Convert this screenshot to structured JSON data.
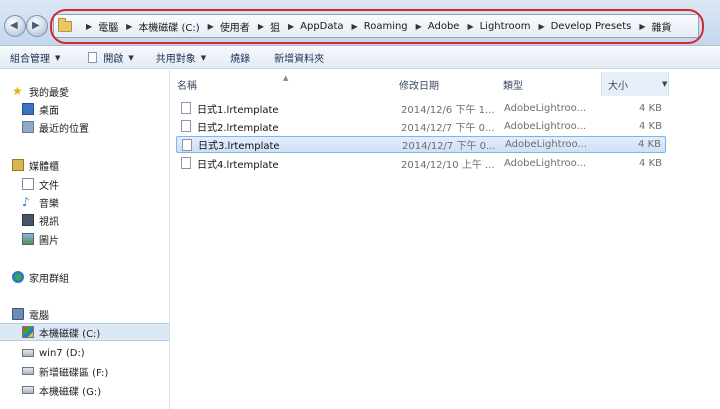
{
  "nav_buttons": {
    "back_icon": "back-arrow-icon",
    "forward_icon": "forward-arrow-icon"
  },
  "breadcrumb": [
    "電腦",
    "本機磁碟 (C:)",
    "使用者",
    "狙",
    "AppData",
    "Roaming",
    "Adobe",
    "Lightroom",
    "Develop Presets",
    "雜貨"
  ],
  "toolbar": {
    "organize_label": "組合管理",
    "open_label": "開啟",
    "share_label": "共用對象",
    "burn_label": "燒錄",
    "new_folder_label": "新增資料夾"
  },
  "navpane": {
    "favorites": {
      "label": "我的最愛",
      "items": [
        "桌面",
        "最近的位置"
      ]
    },
    "libraries": {
      "label": "媒體櫃",
      "items": [
        "文件",
        "音樂",
        "視訊",
        "圖片"
      ]
    },
    "homegroup": {
      "label": "家用群組"
    },
    "computer": {
      "label": "電腦",
      "items": [
        "本機磁碟 (C:)",
        "win7 (D:)",
        "新增磁碟區 (F:)",
        "本機磁碟 (G:)"
      ],
      "selected": "本機磁碟 (C:)"
    }
  },
  "columns": {
    "name": "名稱",
    "date": "修改日期",
    "type": "類型",
    "size": "大小"
  },
  "files": [
    {
      "name": "日式1.lrtemplate",
      "date": "2014/12/6 下午 1...",
      "type": "AdobeLightroo...",
      "size": "4 KB",
      "selected": false
    },
    {
      "name": "日式2.lrtemplate",
      "date": "2014/12/7 下午 0...",
      "type": "AdobeLightroo...",
      "size": "4 KB",
      "selected": false
    },
    {
      "name": "日式3.lrtemplate",
      "date": "2014/12/7 下午 0...",
      "type": "AdobeLightroo...",
      "size": "4 KB",
      "selected": true
    },
    {
      "name": "日式4.lrtemplate",
      "date": "2014/12/10 上午 ...",
      "type": "AdobeLightroo...",
      "size": "4 KB",
      "selected": false
    }
  ],
  "colors": {
    "annotation_outline": "#d62a2a",
    "selection": "#cfe1f7"
  }
}
